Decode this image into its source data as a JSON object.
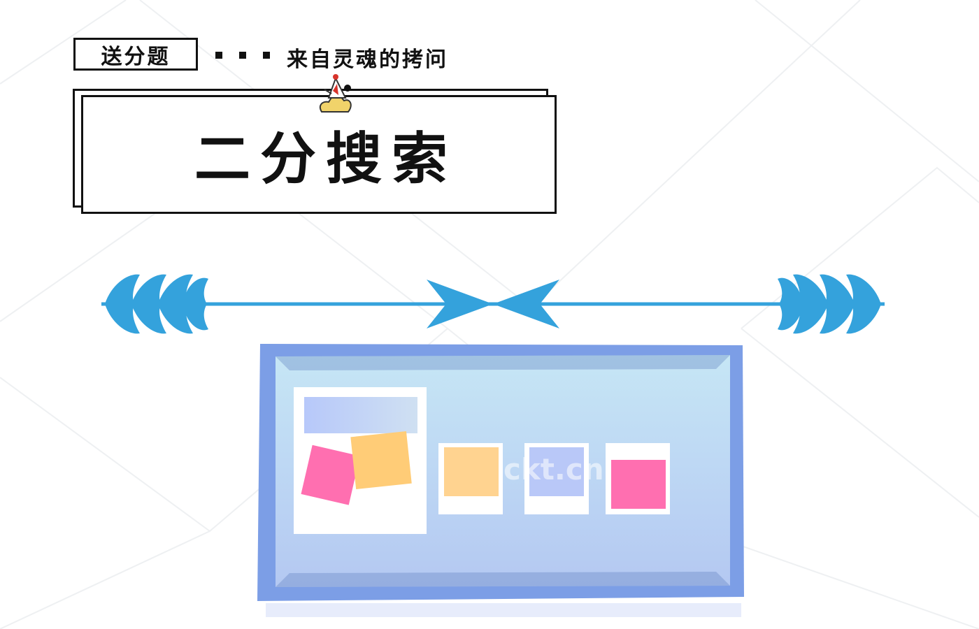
{
  "header": {
    "tag_label": "送分题",
    "subtitle": "来自灵魂的拷问"
  },
  "title": {
    "text": "二分搜索"
  },
  "watermark": {
    "text": "ckt.cn"
  },
  "colors": {
    "accent_blue": "#34a2dc",
    "board_frame": "#7c9ee6",
    "board_inner": "#bfe0f3",
    "sticky_pink": "#ff6fb0",
    "sticky_orange": "#ffcc77",
    "sticky_lavender": "#b9c8f8"
  },
  "icons": [
    "mascot-icon",
    "laurel-left-icon",
    "laurel-right-icon",
    "bowtie-arrow-icon"
  ]
}
